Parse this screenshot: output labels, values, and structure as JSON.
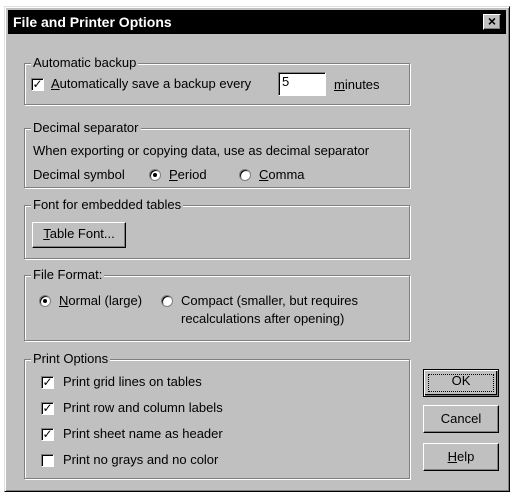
{
  "window": {
    "title": "File and Printer Options",
    "close_glyph": "×"
  },
  "backup": {
    "legend": "Automatic backup",
    "checkbox_checked": true,
    "label_pre": "A",
    "label_rest": "utomatically save a backup every",
    "minutes_value": "5",
    "minutes_pre": "m",
    "minutes_rest": "inutes"
  },
  "decimal": {
    "legend": "Decimal separator",
    "description": "When exporting or copying data, use as decimal separator",
    "symbol_label": "Decimal symbol",
    "options": [
      {
        "pre": "P",
        "rest": "eriod",
        "selected": true
      },
      {
        "pre": "C",
        "rest": "omma",
        "selected": false
      }
    ]
  },
  "font": {
    "legend": "Font for embedded tables",
    "button_pre": "T",
    "button_rest": "able Font..."
  },
  "format": {
    "legend": "File Format:",
    "normal_pre": "N",
    "normal_rest": "ormal (large)",
    "normal_selected": true,
    "compact_line1": "Compact (smaller, but requires",
    "compact_line2": "recalculations after opening)",
    "compact_selected": false
  },
  "print": {
    "legend": "Print Options",
    "items": [
      {
        "label": "Print grid lines on tables",
        "checked": true
      },
      {
        "label": "Print row and column labels",
        "checked": true
      },
      {
        "label": "Print sheet name as header",
        "checked": true
      },
      {
        "label": "Print no grays and no color",
        "checked": false
      }
    ]
  },
  "buttons": {
    "ok": "OK",
    "cancel": "Cancel",
    "help_pre": "H",
    "help_rest": "elp"
  },
  "glyphs": {
    "check": "✓"
  },
  "colors": {
    "face": "#c0c0c0",
    "titlebar": "#000000",
    "title_text": "#ffffff"
  }
}
